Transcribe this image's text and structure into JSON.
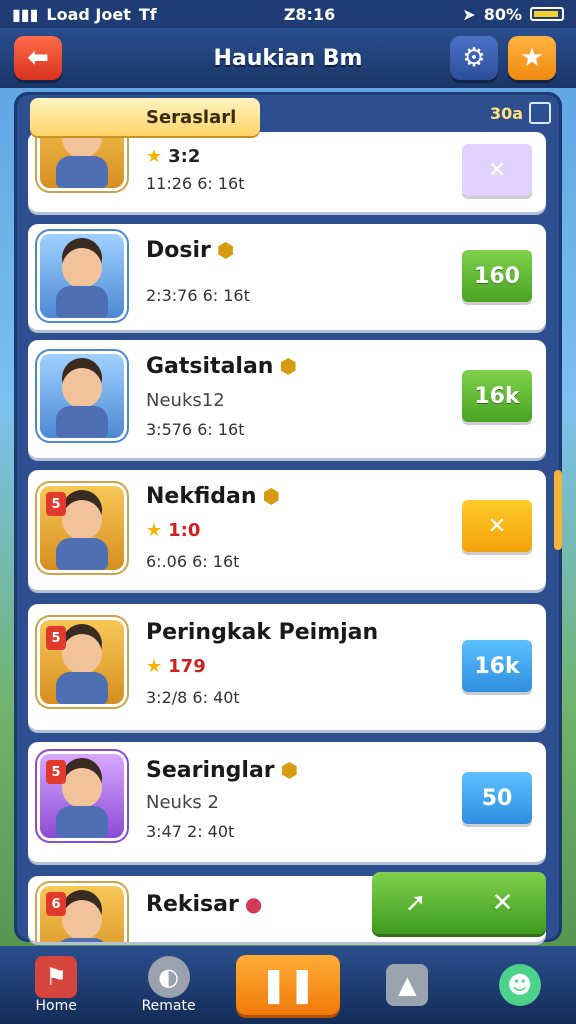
{
  "status_bar": {
    "carrier": "Load Joet",
    "carrier_extra": "Tf",
    "time": "Z8:16",
    "battery": "80%"
  },
  "header": {
    "title": "Haukian Bm",
    "back_icon": "arrow-left-icon",
    "settings_icon": "gear-icon",
    "star_icon": "star-icon"
  },
  "panel": {
    "tab_label": "Seraslarl",
    "count": "30a"
  },
  "items": [
    {
      "level": "3",
      "name": "",
      "rating": "3:2",
      "time": "11:26  6: 16t",
      "action": "✕",
      "action_style": "lavender"
    },
    {
      "level": "",
      "name": "Dosir",
      "sub": "",
      "time": "2:3:76  6: 16t",
      "action": "160",
      "action_style": "green"
    },
    {
      "level": "",
      "name": "Gatsitalan",
      "sub": "Neuks12",
      "time": "3:576  6: 16t",
      "action": "16k",
      "action_style": "green"
    },
    {
      "level": "5",
      "name": "Nekfidan",
      "rating": "1:0",
      "time": "6:.06  6: 16t",
      "action": "✕",
      "action_style": "yellow"
    },
    {
      "level": "5",
      "name": "Peringkak Peimjan",
      "rating": "179",
      "time": "3:2/8  6: 40t",
      "action": "16k",
      "action_style": "blue"
    },
    {
      "level": "5",
      "name": "Searinglar",
      "sub": "Neuks 2",
      "time": "3:47  2: 40t",
      "action": "50",
      "action_style": "blue"
    },
    {
      "level": "6",
      "name": "Rekisar"
    }
  ],
  "wide_button": {
    "left_icon": "arrow-icon",
    "right_label": "✕"
  },
  "navbar": {
    "home": "Home",
    "remote": "Remate",
    "center_icon": "pause-icon",
    "chart_icon": "chart-icon",
    "user_icon": "user-icon"
  }
}
